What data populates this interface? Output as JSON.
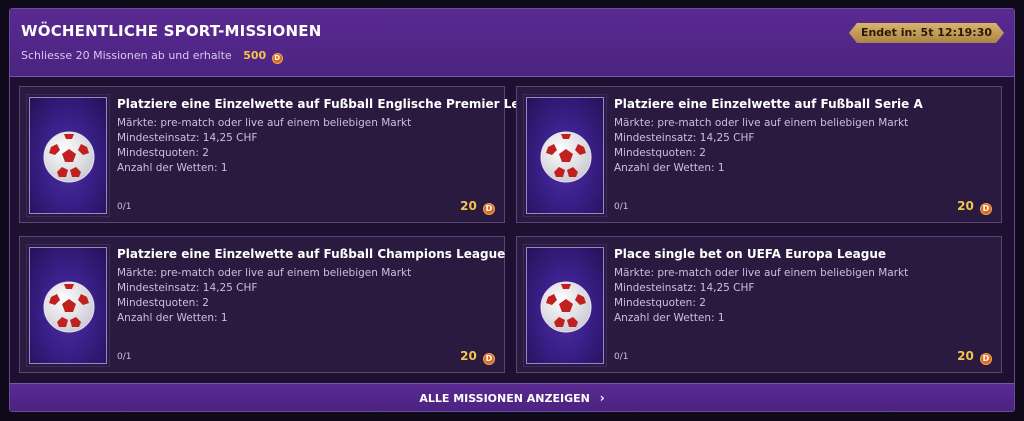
{
  "header": {
    "title": "WÖCHENTLICHE SPORT-MISSIONEN",
    "subtitle": "Schliesse 20 Missionen ab und erhalte",
    "reward_amount": "500",
    "timer": "Endet in: 5t 12:19:30"
  },
  "coin_symbol": "D",
  "missions": [
    {
      "title": "Platziere eine Einzelwette auf Fußball Englische Premier League",
      "markets": "Märkte: pre-match oder live auf einem beliebigen Markt",
      "min_stake": "Mindesteinsatz: 14,25 CHF",
      "min_odds": "Mindestquoten: 2",
      "num_bets": "Anzahl der Wetten: 1",
      "progress": "0/1",
      "reward": "20"
    },
    {
      "title": "Platziere eine Einzelwette auf Fußball Serie A",
      "markets": "Märkte: pre-match oder live auf einem beliebigen Markt",
      "min_stake": "Mindesteinsatz: 14,25 CHF",
      "min_odds": "Mindestquoten: 2",
      "num_bets": "Anzahl der Wetten: 1",
      "progress": "0/1",
      "reward": "20"
    },
    {
      "title": "Platziere eine Einzelwette auf Fußball Champions League",
      "markets": "Märkte: pre-match oder live auf einem beliebigen Markt",
      "min_stake": "Mindesteinsatz: 14,25 CHF",
      "min_odds": "Mindestquoten: 2",
      "num_bets": "Anzahl der Wetten: 1",
      "progress": "0/1",
      "reward": "20"
    },
    {
      "title": "Place single bet on UEFA Europa League",
      "markets": "Märkte: pre-match oder live auf einem beliebigen Markt",
      "min_stake": "Mindesteinsatz: 14,25 CHF",
      "min_odds": "Mindestquoten: 2",
      "num_bets": "Anzahl der Wetten: 1",
      "progress": "0/1",
      "reward": "20"
    }
  ],
  "footer": {
    "button_label": "ALLE MISSIONEN ANZEIGEN"
  }
}
